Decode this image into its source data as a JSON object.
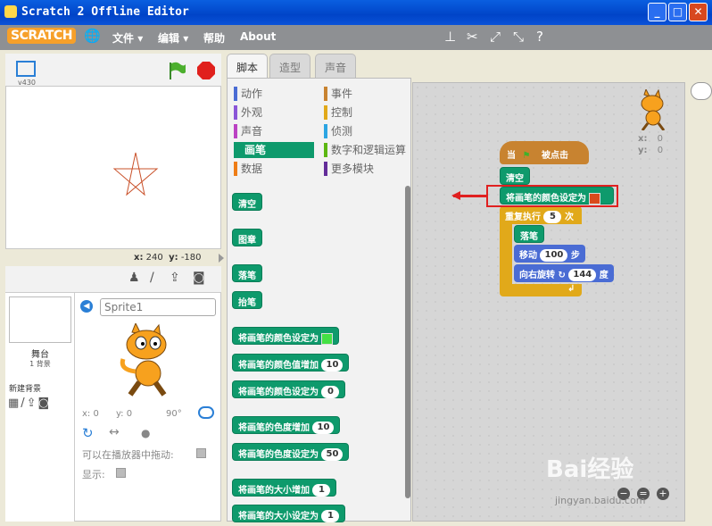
{
  "window": {
    "title": "Scratch 2 Offline Editor"
  },
  "menu": {
    "logo": "SCRATCH",
    "file": "文件",
    "edit": "编辑",
    "help": "帮助",
    "about": "About"
  },
  "stage": {
    "version": "v430",
    "x_label": "x:",
    "x_value": "240",
    "y_label": "y:",
    "y_value": "-180"
  },
  "tabs": {
    "scripts": "脚本",
    "costumes": "造型",
    "sounds": "声音"
  },
  "categories": [
    {
      "label": "动作",
      "color": "#4a6cd4"
    },
    {
      "label": "外观",
      "color": "#8a55d7"
    },
    {
      "label": "声音",
      "color": "#bb42c3"
    },
    {
      "label": "画笔",
      "color": "#0e9a6c"
    },
    {
      "label": "数据",
      "color": "#ee7d16"
    },
    {
      "label": "事件",
      "color": "#c88330"
    },
    {
      "label": "控制",
      "color": "#e1a91a"
    },
    {
      "label": "侦测",
      "color": "#2ca5e2"
    },
    {
      "label": "数字和逻辑运算",
      "color": "#5cb712"
    },
    {
      "label": "更多模块",
      "color": "#632d99"
    }
  ],
  "palette_blocks": {
    "clear": "清空",
    "stamp": "图章",
    "pen_down": "落笔",
    "pen_up": "抬笔",
    "set_color": "将画笔的颜色设定为",
    "change_color": "将画笔的颜色值增加",
    "change_color_val": "10",
    "set_color_val": "将画笔的颜色设定为",
    "set_color_num": "0",
    "change_shade": "将画笔的色度增加",
    "change_shade_val": "10",
    "set_shade": "将画笔的色度设定为",
    "set_shade_val": "50",
    "change_size": "将画笔的大小增加",
    "change_size_val": "1",
    "set_size": "将画笔的大小设定为",
    "set_size_val": "1"
  },
  "sprite_pane": {
    "stage_label": "舞台",
    "backdrop_count": "1 背景",
    "new_backdrop": "新建背景",
    "sprite_name": "Sprite1",
    "x_label": "x:",
    "x_value": "0",
    "y_label": "y:",
    "y_value": "0",
    "direction": "90°",
    "draggable_label": "可以在播放器中拖动:",
    "show_label": "显示:"
  },
  "script": {
    "when_label": "当",
    "clicked": "被点击",
    "clear": "清空",
    "set_color": "将画笔的颜色设定为",
    "repeat": "重复执行",
    "repeat_count": "5",
    "repeat_unit": "次",
    "pen_down": "落笔",
    "move": "移动",
    "move_steps": "100",
    "move_unit": "步",
    "turn": "向右旋转",
    "turn_degrees": "144",
    "turn_unit": "度",
    "sprite_x_label": "x:",
    "sprite_x": "0",
    "sprite_y_label": "y:",
    "sprite_y": "0"
  },
  "watermark": {
    "brand": "Bai经验",
    "url": "jingyan.baidu.com"
  },
  "colors": {
    "pen": "#0e9a6c",
    "event": "#c88330",
    "control": "#e1a91a",
    "motion": "#4a6cd4",
    "highlight": "#e02020"
  }
}
